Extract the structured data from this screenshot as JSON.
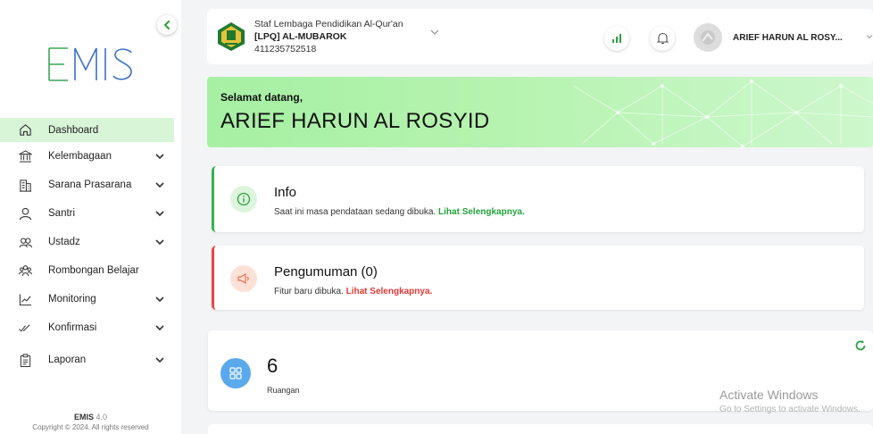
{
  "app": {
    "logo_text": "EMIS"
  },
  "sidebar": {
    "items": [
      {
        "label": "Dashboard",
        "icon": "home-icon",
        "active": true,
        "has_submenu": false
      },
      {
        "label": "Kelembagaan",
        "icon": "institution-icon",
        "active": false,
        "has_submenu": true
      },
      {
        "label": "Sarana Prasarana",
        "icon": "building-icon",
        "active": false,
        "has_submenu": true
      },
      {
        "label": "Santri",
        "icon": "user-icon",
        "active": false,
        "has_submenu": true
      },
      {
        "label": "Ustadz",
        "icon": "users-icon",
        "active": false,
        "has_submenu": true
      },
      {
        "label": "Rombongan Belajar",
        "icon": "group-icon",
        "active": false,
        "has_submenu": false
      },
      {
        "label": "Monitoring",
        "icon": "chart-line-icon",
        "active": false,
        "has_submenu": true
      },
      {
        "label": "Konfirmasi",
        "icon": "check-double-icon",
        "active": false,
        "has_submenu": true
      },
      {
        "label": "Laporan",
        "icon": "clipboard-icon",
        "active": false,
        "has_submenu": true
      }
    ],
    "footer": {
      "version_name": "EMIS",
      "version_number": "4.0",
      "copyright": "Copyright © 2024. All rights reserved"
    }
  },
  "header": {
    "org_role": "Staf Lembaga Pendidikan Al-Qur'an",
    "org_name": "[LPQ] AL-MUBAROK",
    "org_id": "411235752518",
    "user_name": "ARIEF HARUN AL ROSY..."
  },
  "welcome": {
    "greeting": "Selamat datang,",
    "full_name": "ARIEF HARUN AL ROSYID"
  },
  "cards": {
    "info": {
      "title": "Info",
      "text": "Saat ini masa pendataan sedang dibuka.",
      "link": "Lihat Selengkapnya."
    },
    "announcement": {
      "title": "Pengumuman (0)",
      "text": "Fitur baru dibuka.",
      "link": "Lihat Selengkapnya."
    }
  },
  "stats": {
    "rooms": {
      "value": "6",
      "label": "Ruangan"
    }
  },
  "watermark": {
    "title": "Activate Windows",
    "subtitle": "Go to Settings to activate Windows."
  },
  "colors": {
    "accent": "#22a33a",
    "danger": "#e53935",
    "active_bg": "#d8f5d7",
    "stat_icon": "#5aa9ec"
  }
}
